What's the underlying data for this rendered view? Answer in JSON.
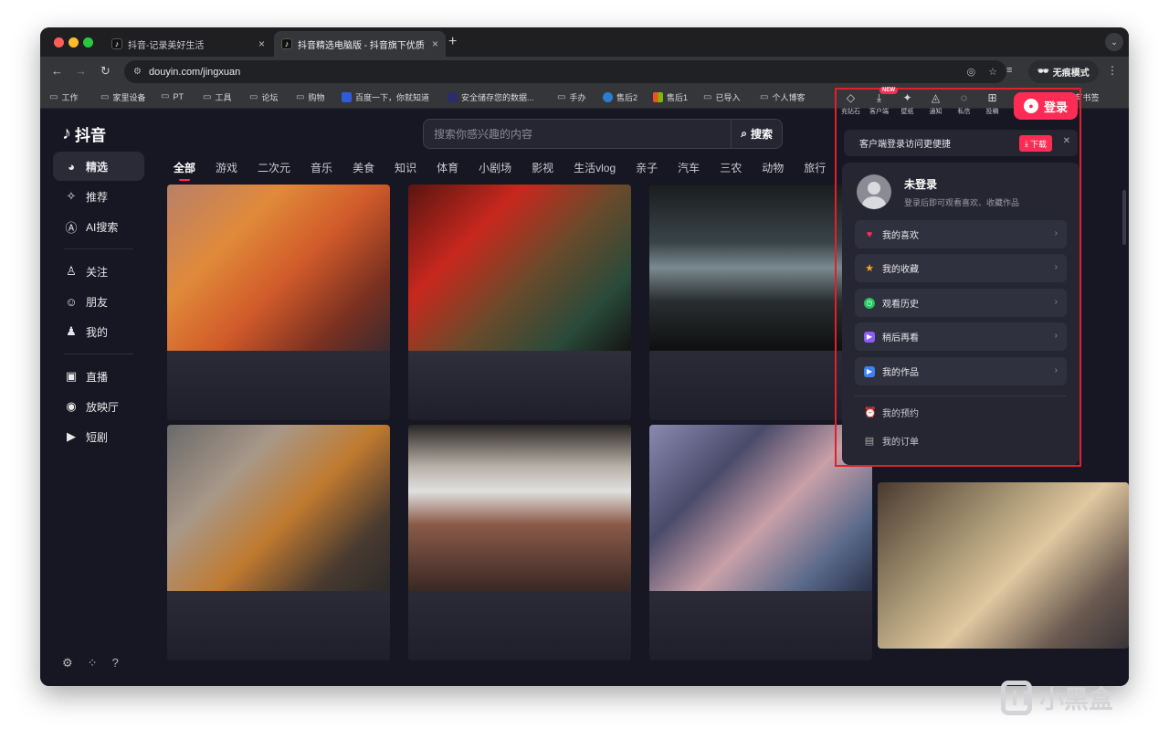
{
  "browser": {
    "tabs": [
      {
        "title": "抖音-记录美好生活",
        "active": false
      },
      {
        "title": "抖音精选电脑版 - 抖音旗下优质",
        "active": true
      }
    ],
    "url": "douyin.com/jingxuan",
    "incognito_label": "无痕模式",
    "bookmarks": [
      {
        "label": "工作",
        "icon": "folder-icon"
      },
      {
        "label": "家里设备",
        "icon": "folder-icon"
      },
      {
        "label": "PT",
        "icon": "folder-icon"
      },
      {
        "label": "工具",
        "icon": "folder-icon"
      },
      {
        "label": "论坛",
        "icon": "folder-icon"
      },
      {
        "label": "购物",
        "icon": "folder-icon"
      },
      {
        "label": "百度一下，你就知道",
        "icon": "baidu-icon"
      },
      {
        "label": "安全储存您的数据...",
        "icon": "site-icon"
      },
      {
        "label": "手办",
        "icon": "folder-icon"
      },
      {
        "label": "售后2",
        "icon": "site-icon"
      },
      {
        "label": "售后1",
        "icon": "microsoft-icon"
      },
      {
        "label": "已导入",
        "icon": "folder-icon"
      },
      {
        "label": "个人博客",
        "icon": "folder-icon"
      }
    ],
    "all_bookmarks_label": "所有书签"
  },
  "header": {
    "logo_text": "抖音",
    "search_placeholder": "搜索你感兴趣的内容",
    "search_button": "搜索",
    "top_icons": [
      {
        "label": "充钻石",
        "icon": "diamond-icon"
      },
      {
        "label": "客户端",
        "icon": "download-icon",
        "badge": "NEW"
      },
      {
        "label": "壁纸",
        "icon": "wallpaper-icon"
      },
      {
        "label": "通知",
        "icon": "bell-icon"
      },
      {
        "label": "私信",
        "icon": "message-icon"
      },
      {
        "label": "投稿",
        "icon": "upload-icon"
      }
    ],
    "login_button": "登录"
  },
  "sidebar": {
    "items": [
      {
        "label": "精选",
        "icon": "featured-icon",
        "active": true
      },
      {
        "label": "推荐",
        "icon": "sparkle-icon"
      },
      {
        "label": "AI搜索",
        "icon": "ai-search-icon"
      },
      {
        "label": "关注",
        "icon": "follow-icon"
      },
      {
        "label": "朋友",
        "icon": "friends-icon"
      },
      {
        "label": "我的",
        "icon": "user-icon"
      },
      {
        "label": "直播",
        "icon": "live-tv-icon"
      },
      {
        "label": "放映厅",
        "icon": "cinema-icon"
      },
      {
        "label": "短剧",
        "icon": "drama-icon"
      }
    ]
  },
  "categories": [
    "全部",
    "游戏",
    "二次元",
    "音乐",
    "美食",
    "知识",
    "体育",
    "小剧场",
    "影视",
    "生活vlog",
    "亲子",
    "汽车",
    "三农",
    "动物",
    "旅行"
  ],
  "download_banner": {
    "text": "客户端登录访问更便捷",
    "button": "下载"
  },
  "user_panel": {
    "name": "未登录",
    "subtitle": "登录后即可观看喜欢、收藏作品",
    "menu": [
      {
        "label": "我的喜欢",
        "icon": "heart-icon",
        "color": "#fe2c55"
      },
      {
        "label": "我的收藏",
        "icon": "star-icon",
        "color": "#f5a623"
      },
      {
        "label": "观看历史",
        "icon": "clock-icon",
        "color": "#22c55e"
      },
      {
        "label": "稍后再看",
        "icon": "watch-later-icon",
        "color": "#8b5cf6"
      },
      {
        "label": "我的作品",
        "icon": "play-icon",
        "color": "#3b82f6"
      }
    ],
    "plain_items": [
      {
        "label": "我的预约",
        "icon": "alarm-icon"
      },
      {
        "label": "我的订单",
        "icon": "order-icon"
      }
    ]
  },
  "watermark_text": "小黑盒",
  "colors": {
    "accent": "#fe2c55",
    "background": "#161722",
    "panel": "#252632",
    "highlight_border": "#e0202d"
  }
}
